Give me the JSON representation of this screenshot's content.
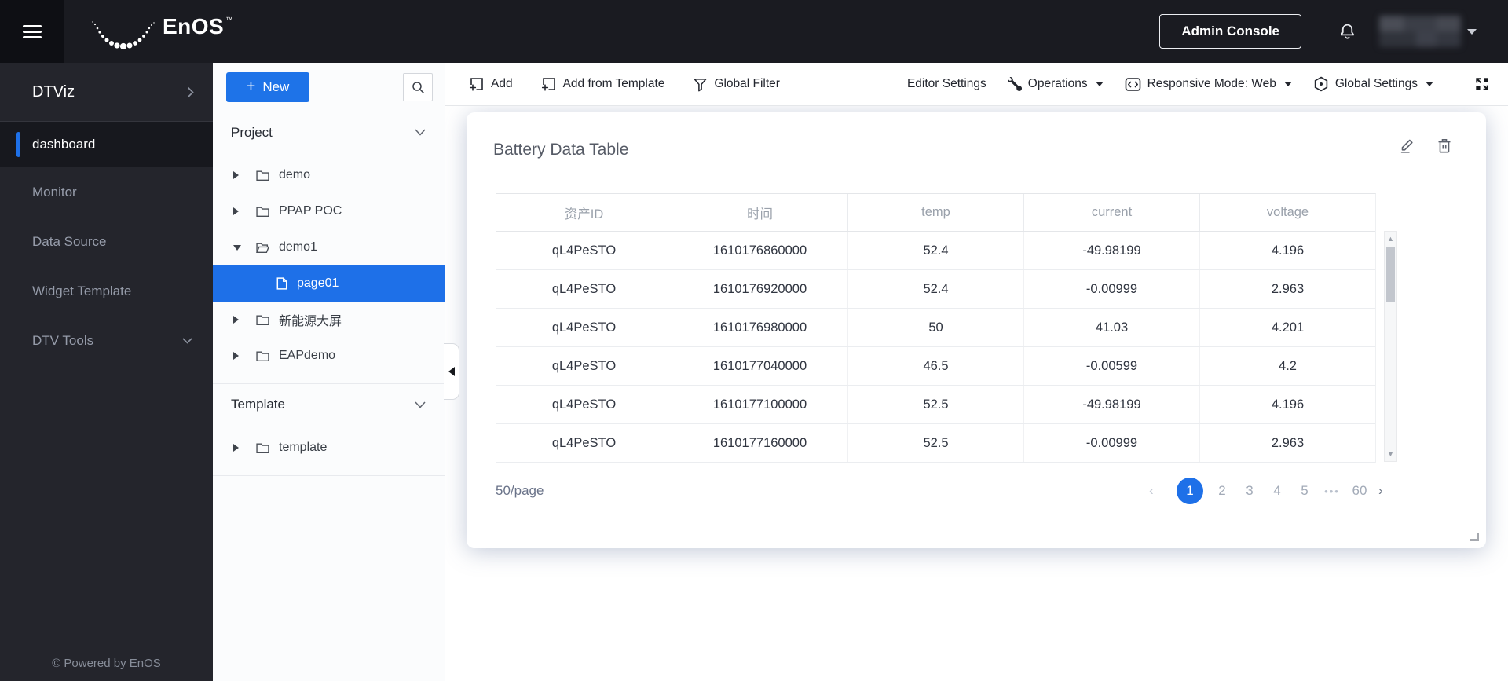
{
  "topbar": {
    "brand": "EnOS",
    "brand_tm": "™",
    "admin_console_label": "Admin Console"
  },
  "sidebar": {
    "app_title": "DTViz",
    "items": [
      {
        "label": "dashboard",
        "active": true
      },
      {
        "label": "Monitor"
      },
      {
        "label": "Data Source"
      },
      {
        "label": "Widget Template"
      },
      {
        "label": "DTV Tools"
      }
    ],
    "footer": "© Powered by EnOS"
  },
  "explorer": {
    "new_button_label": "New",
    "sections": [
      {
        "title": "Project",
        "items": [
          {
            "label": "demo",
            "type": "folder"
          },
          {
            "label": "PPAP POC",
            "type": "folder"
          },
          {
            "label": "demo1",
            "type": "folder-open"
          },
          {
            "label": "page01",
            "type": "page",
            "selected": true
          },
          {
            "label": "新能源大屏",
            "type": "folder"
          },
          {
            "label": "EAPdemo",
            "type": "folder"
          }
        ]
      },
      {
        "title": "Template",
        "items": [
          {
            "label": "template",
            "type": "folder"
          }
        ]
      }
    ]
  },
  "toolbar": {
    "left": [
      {
        "label": "Add"
      },
      {
        "label": "Add from Template"
      },
      {
        "label": "Global Filter"
      }
    ],
    "right": [
      {
        "label": "Editor Settings"
      },
      {
        "label": "Operations",
        "dropdown": true
      },
      {
        "label": "Responsive Mode: Web",
        "dropdown": true
      },
      {
        "label": "Global Settings",
        "dropdown": true
      }
    ]
  },
  "widget": {
    "title": "Battery Data Table",
    "table": {
      "columns": [
        "资产ID",
        "时间",
        "temp",
        "current",
        "voltage"
      ],
      "rows": [
        [
          "qL4PeSTO",
          "1610176860000",
          "52.4",
          "-49.98199",
          "4.196"
        ],
        [
          "qL4PeSTO",
          "1610176920000",
          "52.4",
          "-0.00999",
          "2.963"
        ],
        [
          "qL4PeSTO",
          "1610176980000",
          "50",
          "41.03",
          "4.201"
        ],
        [
          "qL4PeSTO",
          "1610177040000",
          "46.5",
          "-0.00599",
          "4.2"
        ],
        [
          "qL4PeSTO",
          "1610177100000",
          "52.5",
          "-49.98199",
          "4.196"
        ],
        [
          "qL4PeSTO",
          "1610177160000",
          "52.5",
          "-0.00999",
          "2.963"
        ]
      ]
    },
    "pagination": {
      "page_size_label": "50/page",
      "prev": "‹",
      "pages": [
        "1",
        "2",
        "3",
        "4",
        "5"
      ],
      "ellipsis": "•••",
      "last_page": "60",
      "next": "›",
      "current_page": "1"
    }
  },
  "icons": {
    "plus": "+"
  },
  "colors": {
    "accent_blue": "#1e70e8",
    "topbar_bg": "#1a1b21",
    "sidebar_bg": "#24252c",
    "selected_row": "#1e70e8"
  }
}
